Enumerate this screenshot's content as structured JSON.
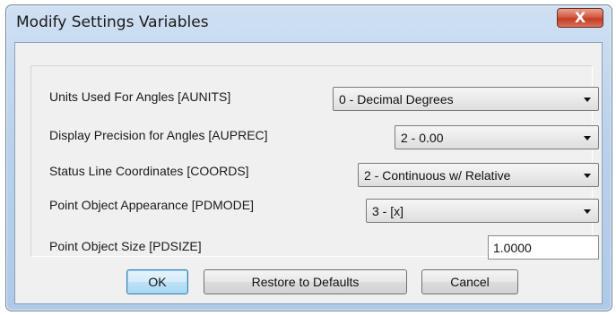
{
  "window": {
    "title": "Modify Settings Variables",
    "close_glyph": "X"
  },
  "settings": {
    "aunits": {
      "label": "Units Used For Angles [AUNITS]",
      "value": "0 - Decimal Degrees"
    },
    "auprec": {
      "label": "Display Precision for Angles [AUPREC]",
      "value": "2 - 0.00"
    },
    "coords": {
      "label": "Status Line Coordinates [COORDS]",
      "value": "2 - Continuous w/ Relative"
    },
    "pdmode": {
      "label": "Point Object Appearance [PDMODE]",
      "value": "3 - [x]"
    },
    "pdsize": {
      "label": "Point Object Size [PDSIZE]",
      "value": "1.0000"
    }
  },
  "buttons": {
    "ok": "OK",
    "restore": "Restore to Defaults",
    "cancel": "Cancel"
  }
}
